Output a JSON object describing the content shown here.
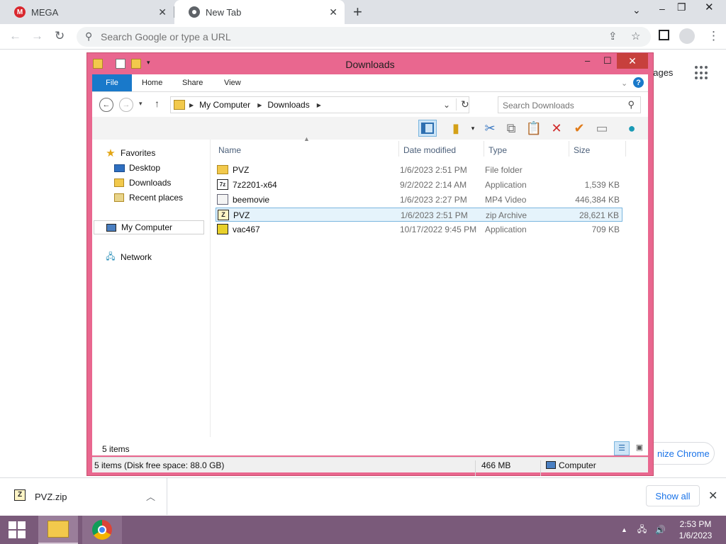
{
  "browser": {
    "tabs": [
      {
        "label": "MEGA",
        "favicon": "mega-icon"
      },
      {
        "label": "New Tab",
        "favicon": "chrome-icon"
      }
    ],
    "omnibox_placeholder": "Search Google or type a URL",
    "ntp": {
      "images_link": "nages",
      "customize_label": "nize Chrome"
    }
  },
  "explorer": {
    "title": "Downloads",
    "ribbon_tabs": [
      "File",
      "Home",
      "Share",
      "View"
    ],
    "breadcrumb": [
      "My Computer",
      "Downloads"
    ],
    "search_placeholder": "Search Downloads",
    "nav": {
      "favorites": "Favorites",
      "desktop": "Desktop",
      "downloads": "Downloads",
      "recent": "Recent places",
      "computer": "My Computer",
      "network": "Network"
    },
    "columns": {
      "name": "Name",
      "date": "Date modified",
      "type": "Type",
      "size": "Size"
    },
    "files": [
      {
        "name": "PVZ",
        "date": "1/6/2023 2:51 PM",
        "type": "File folder",
        "size": "",
        "icon": "folder-icon"
      },
      {
        "name": "7z2201-x64",
        "date": "9/2/2022 2:14 AM",
        "type": "Application",
        "size": "1,539 KB",
        "icon": "7zip-icon"
      },
      {
        "name": "beemovie",
        "date": "1/6/2023 2:27 PM",
        "type": "MP4 Video",
        "size": "446,384 KB",
        "icon": "video-file-icon"
      },
      {
        "name": "PVZ",
        "date": "1/6/2023 2:51 PM",
        "type": "zip Archive",
        "size": "28,621 KB",
        "icon": "zip-archive-icon"
      },
      {
        "name": "vac467",
        "date": "10/17/2022 9:45 PM",
        "type": "Application",
        "size": "709 KB",
        "icon": "application-icon"
      }
    ],
    "item_count": "5 items",
    "status": {
      "summary": "5 items (Disk free space: 88.0 GB)",
      "size": "466 MB",
      "location": "Computer"
    }
  },
  "downloads_shelf": {
    "item": "PVZ.zip",
    "show_all": "Show all"
  },
  "taskbar": {
    "time": "2:53 PM",
    "date": "1/6/2023"
  },
  "colors": {
    "window_frame": "#e9678f",
    "file_tab": "#1979ca",
    "close_button": "#c7403d",
    "taskbar": "#7a5a7a",
    "selection": "#e5f3fb"
  }
}
